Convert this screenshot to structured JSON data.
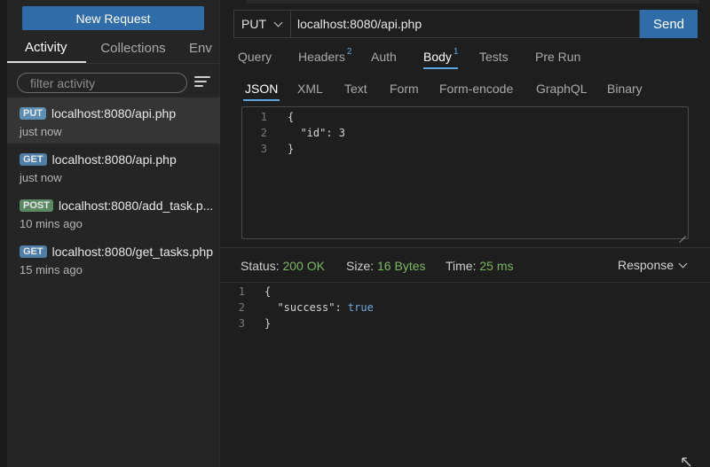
{
  "sidebar": {
    "new_request_label": "New Request",
    "tabs": [
      {
        "label": "Activity",
        "active": true
      },
      {
        "label": "Collections",
        "active": false
      },
      {
        "label": "Env",
        "active": false
      }
    ],
    "filter_placeholder": "filter activity",
    "activity": [
      {
        "method": "PUT",
        "url": "localhost:8080/api.php",
        "time": "just now",
        "selected": true
      },
      {
        "method": "GET",
        "url": "localhost:8080/api.php",
        "time": "just now",
        "selected": false
      },
      {
        "method": "POST",
        "url": "localhost:8080/add_task.p...",
        "time": "10 mins ago",
        "selected": false
      },
      {
        "method": "GET",
        "url": "localhost:8080/get_tasks.php",
        "time": "15 mins ago",
        "selected": false
      }
    ]
  },
  "request": {
    "method": "PUT",
    "url": "localhost:8080/api.php",
    "send_label": "Send",
    "tabs": [
      {
        "label": "Query",
        "count": ""
      },
      {
        "label": "Headers",
        "count": "2"
      },
      {
        "label": "Auth",
        "count": ""
      },
      {
        "label": "Body",
        "count": "1",
        "active": true
      },
      {
        "label": "Tests",
        "count": ""
      },
      {
        "label": "Pre Run",
        "count": ""
      }
    ],
    "body_tabs": [
      {
        "label": "JSON",
        "active": true
      },
      {
        "label": "XML"
      },
      {
        "label": "Text"
      },
      {
        "label": "Form"
      },
      {
        "label": "Form-encode"
      },
      {
        "label": "GraphQL"
      },
      {
        "label": "Binary"
      }
    ],
    "body_lines": [
      {
        "num": "1",
        "text": "{"
      },
      {
        "num": "2",
        "text": "  \"id\": 3"
      },
      {
        "num": "3",
        "text": "}"
      }
    ]
  },
  "response": {
    "status_label": "Status:",
    "status_value": "200 OK",
    "size_label": "Size:",
    "size_value": "16 Bytes",
    "time_label": "Time:",
    "time_value": "25 ms",
    "view_label": "Response",
    "lines": [
      {
        "num": "1",
        "text": "{"
      },
      {
        "num": "2",
        "key": "  \"success\": ",
        "value": "true"
      },
      {
        "num": "3",
        "text": "}"
      }
    ]
  },
  "colors": {
    "accent": "#2f6ca8",
    "tab_indicator": "#5ba6e0",
    "success": "#7ab85d"
  }
}
